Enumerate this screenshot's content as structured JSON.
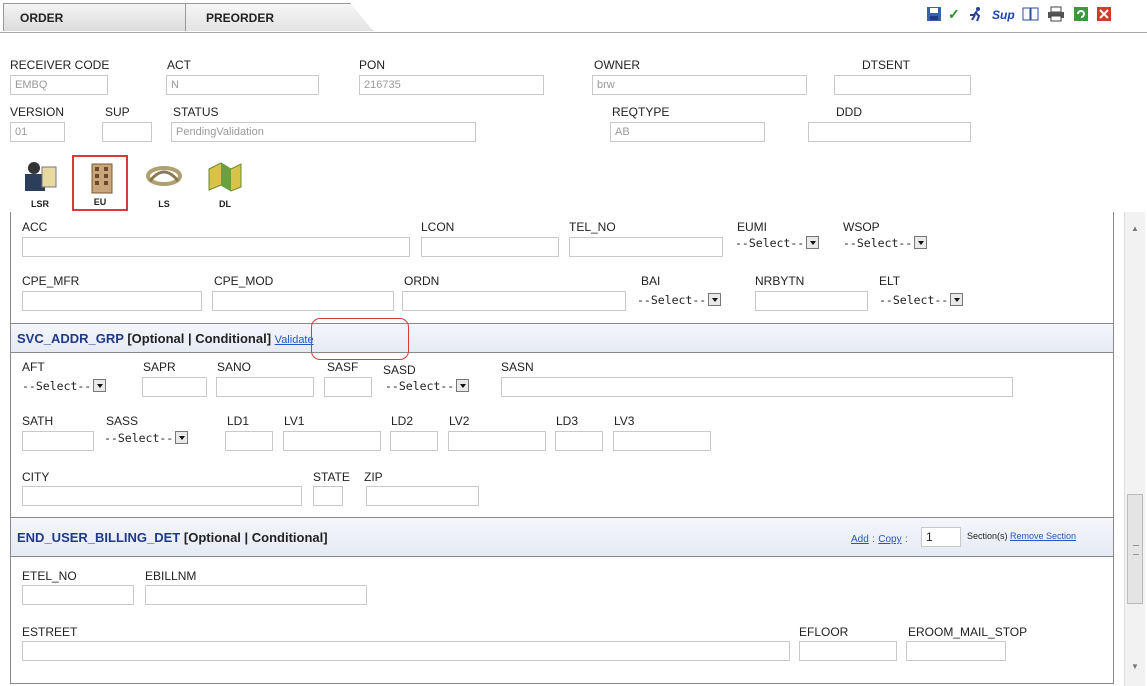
{
  "tabs": {
    "order": "ORDER",
    "preorder": "PREORDER"
  },
  "toolbar": {
    "icons": [
      "save-icon",
      "check-icon",
      "run-icon",
      "sup-icon",
      "book-icon",
      "print-icon",
      "refresh-icon",
      "close-icon"
    ],
    "sup_label": "Sup"
  },
  "header": {
    "receiver_code": {
      "label": "RECEIVER CODE",
      "value": "EMBQ"
    },
    "act": {
      "label": "ACT",
      "value": "N"
    },
    "pon": {
      "label": "PON",
      "value": "216735"
    },
    "owner": {
      "label": "OWNER",
      "value": "brw"
    },
    "dtsent": {
      "label": "DTSENT",
      "value": ""
    },
    "version": {
      "label": "VERSION",
      "value": "01"
    },
    "sup": {
      "label": "SUP",
      "value": ""
    },
    "status": {
      "label": "STATUS",
      "value": "PendingValidation"
    },
    "reqtype": {
      "label": "REQTYPE",
      "value": "AB"
    },
    "ddd": {
      "label": "DDD",
      "value": ""
    }
  },
  "form_icons": [
    {
      "label": "LSR",
      "selected": false
    },
    {
      "label": "EU",
      "selected": true
    },
    {
      "label": "LS",
      "selected": false
    },
    {
      "label": "DL",
      "selected": false
    }
  ],
  "eu_fields": {
    "acc": "ACC",
    "lcon": "LCON",
    "tel_no": "TEL_NO",
    "eumi": "EUMI",
    "wsop": "WSOP",
    "cpe_mfr": "CPE_MFR",
    "cpe_mod": "CPE_MOD",
    "ordn": "ORDN",
    "bai": "BAI",
    "nrbytn": "NRBYTN",
    "elt": "ELT",
    "select_placeholder": "--Select--"
  },
  "svc_addr": {
    "title": "SVC_ADDR_GRP",
    "qualifier": "[Optional | Conditional]",
    "validate_link": "Validate",
    "aft": "AFT",
    "sapr": "SAPR",
    "sano": "SANO",
    "sasf": "SASF",
    "sasd": "SASD",
    "sasn": "SASN",
    "sath": "SATH",
    "sass": "SASS",
    "ld1": "LD1",
    "lv1": "LV1",
    "ld2": "LD2",
    "lv2": "LV2",
    "ld3": "LD3",
    "lv3": "LV3",
    "city": "CITY",
    "state": "STATE",
    "zip": "ZIP"
  },
  "billing": {
    "title": "END_USER_BILLING_DET",
    "qualifier": "[Optional | Conditional]",
    "add_link": "Add",
    "copy_link": "Copy",
    "copy_count": "1",
    "sections_label": "Section(s)",
    "remove_link": "Remove Section",
    "etel_no": "ETEL_NO",
    "ebillnm": "EBILLNM",
    "estreet": "ESTREET",
    "efloor": "EFLOOR",
    "eroom_mail_stop": "EROOM_MAIL_STOP"
  },
  "colors": {
    "section_title": "#1f3a8a",
    "link": "#2356c8",
    "highlight": "#d83a3a"
  }
}
